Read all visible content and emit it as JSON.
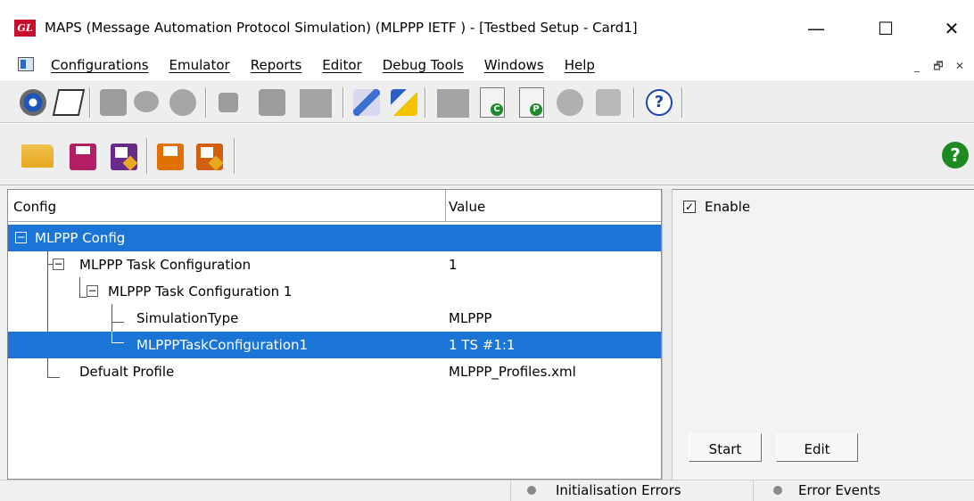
{
  "window": {
    "title": "MAPS (Message Automation Protocol Simulation)  (MLPPP IETF ) - [Testbed Setup - Card1]",
    "logo_text": "GL",
    "minimize_glyph": "—",
    "maximize_glyph": "☐",
    "close_glyph": "✕"
  },
  "menubar": {
    "items": [
      "Configurations",
      "Emulator",
      "Reports",
      "Editor",
      "Debug Tools",
      "Windows",
      "Help"
    ],
    "mdi_minimize": "_",
    "mdi_restore": "🗗",
    "mdi_close": "✕"
  },
  "toolbar2": {
    "help_glyph": "?"
  },
  "toolbar1": {
    "doc_c_letter": "C",
    "doc_p_letter": "P",
    "help_glyph": "?"
  },
  "tree": {
    "columns": [
      "Config",
      "Value"
    ],
    "rows": [
      {
        "label": "MLPPP Config",
        "value": ""
      },
      {
        "label": "MLPPP Task Configuration",
        "value": "1"
      },
      {
        "label": "MLPPP Task Configuration 1",
        "value": ""
      },
      {
        "label": "SimulationType",
        "value": "MLPPP"
      },
      {
        "label": "MLPPPTaskConfiguration1",
        "value": "1 TS #1:1"
      },
      {
        "label": "Defualt Profile",
        "value": "MLPPP_Profiles.xml"
      }
    ],
    "expander_glyph": "−"
  },
  "right_panel": {
    "enable_label": "Enable",
    "enable_checked": "✓",
    "start_button": "Start",
    "edit_button": "Edit"
  },
  "statusbar": {
    "init_errors": "Initialisation Errors",
    "error_events": "Error Events"
  },
  "colors": {
    "selection": "#1b75d6"
  }
}
